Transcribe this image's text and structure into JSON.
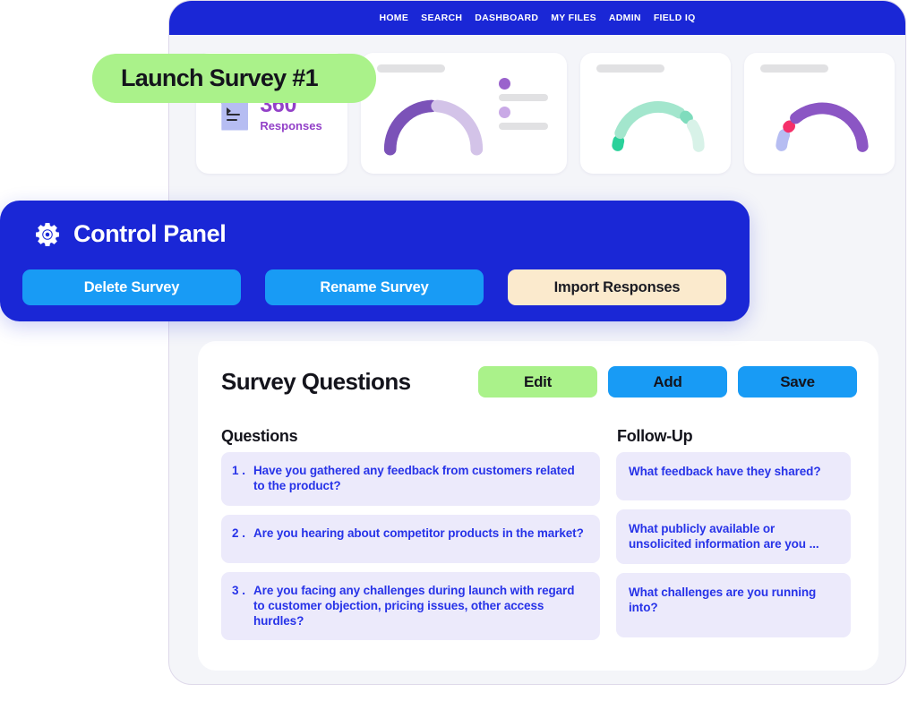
{
  "nav": {
    "links": [
      "HOME",
      "SEARCH",
      "DASHBOARD",
      "MY FILES",
      "ADMIN",
      "FIELD IQ"
    ]
  },
  "launch_badge": {
    "label": "Launch Survey #1"
  },
  "kpi_cards": {
    "responses": {
      "value": "360",
      "label": "Responses",
      "icon": "document-icon",
      "accent": "#9341c8"
    },
    "gauge_1": {
      "title_placeholder": "",
      "segments": [
        {
          "color": "#7b52b8",
          "portion": 0.46
        },
        {
          "color": "#d3c3e8",
          "portion": 0.52
        }
      ],
      "legend": [
        {
          "dot_color": "#9a62cc"
        },
        {
          "dot_color": "#c9a9e6"
        }
      ]
    },
    "gauge_2": {
      "segments": [
        {
          "color": "#2ad19a",
          "portion": 0.08
        },
        {
          "color": "#a3e6cd",
          "portion": 0.58
        },
        {
          "color": "#7fdcbd",
          "portion": 0.06
        },
        {
          "color": "#d8f2e8",
          "portion": 0.26
        }
      ]
    },
    "gauge_3": {
      "segments": [
        {
          "color": "#b6bdf2",
          "portion": 0.13
        },
        {
          "color": "#f5306a",
          "portion": 0.06
        },
        {
          "color": "#8b56c4",
          "portion": 0.79
        }
      ]
    }
  },
  "control_panel": {
    "icon": "gear-icon",
    "title": "Control Panel",
    "buttons": {
      "delete": "Delete Survey",
      "rename": "Rename Survey",
      "import": "Import Responses"
    },
    "colors": {
      "panel": "#1a27d6",
      "action": "#189bf5",
      "import": "#fbeacd"
    }
  },
  "survey_questions": {
    "title": "Survey Questions",
    "actions": {
      "edit": "Edit",
      "add": "Add",
      "save": "Save"
    },
    "columns": {
      "questions": "Questions",
      "followup": "Follow-Up"
    },
    "questions": [
      {
        "num": "1 .",
        "text": "Have you gathered any feedback from customers related to the product?"
      },
      {
        "num": "2 .",
        "text": "Are you hearing about competitor products in the market?"
      },
      {
        "num": "3 .",
        "text": "Are you facing any challenges during launch with regard to customer objection, pricing issues, other access hurdles?"
      }
    ],
    "followups": [
      {
        "text": "What feedback have they shared?"
      },
      {
        "text": "What publicly available or unsolicited information are you  ..."
      },
      {
        "text": "What challenges are you running into?"
      }
    ],
    "colors": {
      "item_bg": "#eceafb",
      "item_text": "#2733e8",
      "edit": "#aaf28a",
      "add": "#189bf5",
      "save": "#189bf5"
    }
  }
}
